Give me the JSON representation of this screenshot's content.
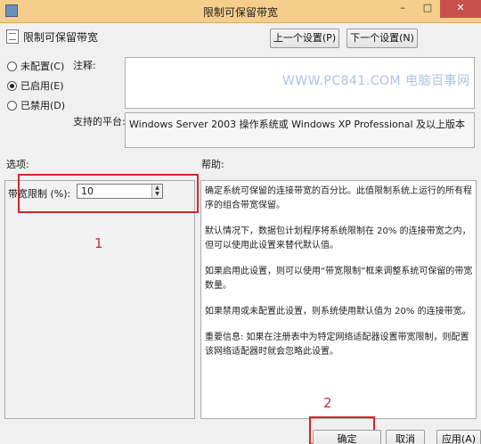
{
  "window": {
    "title": "限制可保留带宽",
    "minimize": "–",
    "maximize": "□",
    "close": "✕"
  },
  "header": {
    "title": "限制可保留带宽",
    "prev_label": "上一个设置(P)",
    "next_label": "下一个设置(N)"
  },
  "state": {
    "options": [
      {
        "label": "未配置(C)",
        "checked": false
      },
      {
        "label": "已启用(E)",
        "checked": true
      },
      {
        "label": "已禁用(D)",
        "checked": false
      }
    ]
  },
  "comment": {
    "label": "注释:",
    "value": ""
  },
  "watermark": "WWW.PC841.COM 电脑百事网",
  "platform": {
    "label": "支持的平台:",
    "value": "Windows Server 2003 操作系统或 Windows XP Professional 及以上版本"
  },
  "options_section": {
    "heading": "选项:",
    "field_label": "带宽限制 (%):",
    "field_value": "10"
  },
  "help_section": {
    "heading": "帮助:",
    "paragraphs": [
      "确定系统可保留的连接带宽的百分比。此值限制系统上运行的所有程序的组合带宽保留。",
      "默认情况下，数据包计划程序将系统限制在 20% 的连接带宽之内，但可以使用此设置来替代默认值。",
      "如果启用此设置，则可以使用“带宽限制”框来调整系统可保留的带宽数量。",
      "如果禁用或未配置此设置，则系统使用默认值为 20% 的连接带宽。",
      "重要信息: 如果在注册表中为特定网络适配器设置带宽限制，则配置该网络适配器时就会忽略此设置。"
    ]
  },
  "annotations": {
    "marker_1": "1",
    "marker_2": "2"
  },
  "footer": {
    "ok": "确定",
    "cancel": "取消",
    "apply": "应用(A)"
  }
}
